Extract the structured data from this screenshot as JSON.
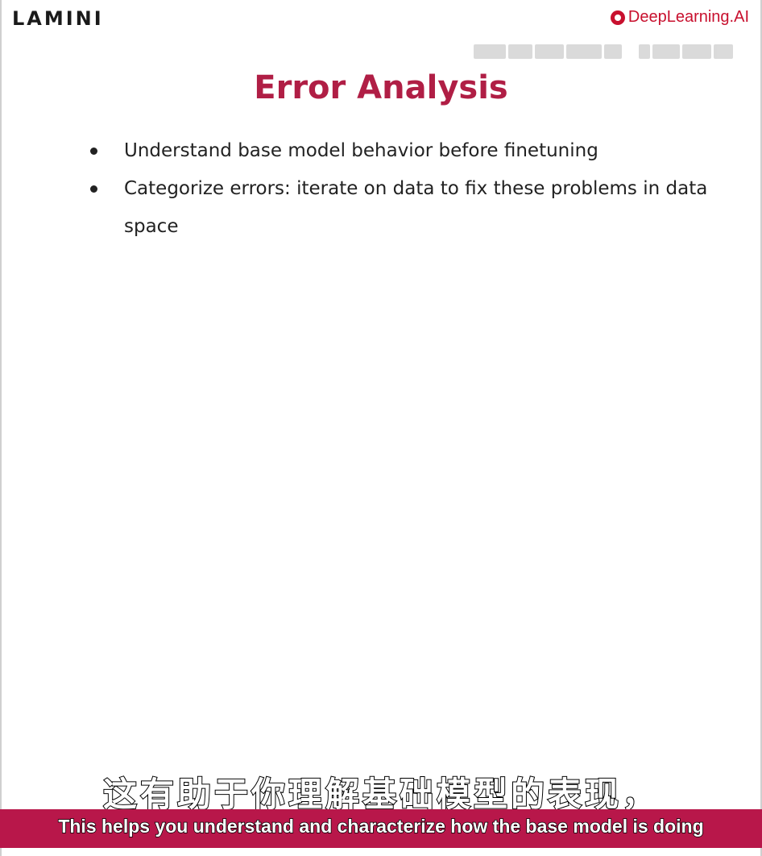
{
  "brand": {
    "left_logo": "LAMINI",
    "right_logo": "DeepLearning.AI",
    "accent_color": "#b01e45"
  },
  "slide": {
    "title": "Error Analysis",
    "bullets": [
      "Understand base model behavior before finetuning",
      "Categorize errors: iterate on data to fix these problems in data space"
    ]
  },
  "subtitles": {
    "zh": "这有助于你理解基础模型的表现，",
    "en": "This helps you understand and characterize how the base model is doing",
    "bar_color": "#b8174a"
  }
}
